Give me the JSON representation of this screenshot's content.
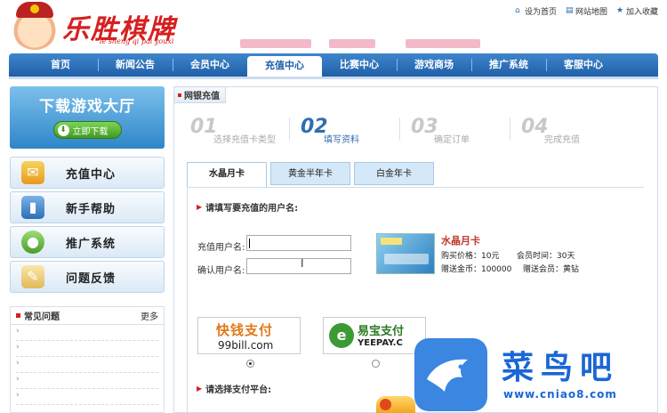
{
  "header": {
    "logo_text": "乐胜棋牌",
    "logo_sub": "le sheng qi pai youxi",
    "top_links": [
      {
        "label": "设为首页",
        "icon": "house-icon"
      },
      {
        "label": "网站地图",
        "icon": "map-icon"
      },
      {
        "label": "加入收藏",
        "icon": "star-icon"
      }
    ]
  },
  "nav": {
    "items": [
      {
        "label": "首页"
      },
      {
        "label": "新闻公告"
      },
      {
        "label": "会员中心"
      },
      {
        "label": "充值中心",
        "active": true
      },
      {
        "label": "比赛中心"
      },
      {
        "label": "游戏商场"
      },
      {
        "label": "推广系统"
      },
      {
        "label": "客服中心"
      }
    ]
  },
  "sidebar": {
    "download_title": "下载游戏大厅",
    "download_button": "立即下载",
    "menu": [
      {
        "label": "充值中心",
        "icon": "recharge-icon"
      },
      {
        "label": "新手帮助",
        "icon": "help-book-icon"
      },
      {
        "label": "推广系统",
        "icon": "promotion-icon"
      },
      {
        "label": "问题反馈",
        "icon": "feedback-icon"
      }
    ],
    "faq_title": "常见问题",
    "faq_more": "更多"
  },
  "main": {
    "tab": "网银充值",
    "steps": [
      {
        "num": "01",
        "label": "选择充值卡类型"
      },
      {
        "num": "02",
        "label": "填写资料",
        "current": true
      },
      {
        "num": "03",
        "label": "确定订单"
      },
      {
        "num": "04",
        "label": "完成充值"
      }
    ],
    "card_tabs": [
      {
        "label": "水晶月卡",
        "active": true
      },
      {
        "label": "黄金半年卡"
      },
      {
        "label": "白金年卡"
      }
    ],
    "section_user": "请填写要充值的用户名:",
    "field_user_label": "充值用户名:",
    "field_confirm_label": "确认用户名:",
    "field_user_value": "",
    "field_confirm_value": "",
    "product": {
      "name": "水晶月卡",
      "price": "购买价格：10元",
      "duration": "会员时间：30天",
      "gold": "赠送金币：100000",
      "member": "赠送会员：黄钻"
    },
    "section_pay": "请选择支付平台:",
    "payments": [
      {
        "name": "快钱支付",
        "sub": "99bill.com",
        "selected": true
      },
      {
        "name": "易宝支付",
        "sub": "YEEPAY.C",
        "selected": false
      }
    ]
  },
  "watermark": {
    "text": "菜鸟吧",
    "url": "www.cniao8.com"
  },
  "colors": {
    "nav_blue": "#1f5fa8",
    "accent_red": "#d62020",
    "watermark_blue": "#1a66d6"
  }
}
